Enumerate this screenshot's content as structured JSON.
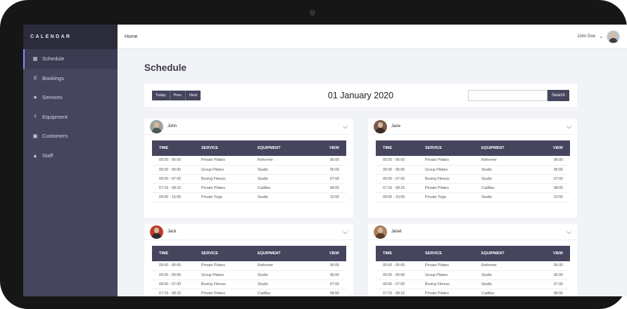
{
  "brand": "CALENDAR",
  "sidebar": {
    "items": [
      {
        "label": "Schedule",
        "icon": "calendar-icon"
      },
      {
        "label": "Bookings",
        "icon": "hourglass-icon"
      },
      {
        "label": "Services",
        "icon": "star-icon"
      },
      {
        "label": "Equipment",
        "icon": "dumbbell-icon"
      },
      {
        "label": "Customers",
        "icon": "id-card-icon"
      },
      {
        "label": "Staff",
        "icon": "user-icon"
      }
    ]
  },
  "topbar": {
    "breadcrumb": "Home",
    "user_name": "John Doe",
    "dropdown_icon": "chevron-down-icon"
  },
  "page": {
    "title": "Schedule"
  },
  "toolbar": {
    "today": "Today",
    "prev": "Prev",
    "next": "Next",
    "date": "01 January 2020",
    "search_placeholder": "",
    "search_button": "Search"
  },
  "columns": {
    "time": "TIME",
    "service": "SERVICE",
    "equipment": "EQUIPMENT",
    "view": "VIEW"
  },
  "colors": {
    "sidebar": "#45455e",
    "sidebar_dark": "#2b2b3b",
    "accent": "#8a8aff",
    "background": "#f2f3f7"
  },
  "cards": [
    {
      "name": "John",
      "rows": [
        [
          "05:00 - 06:00",
          "Private Pilates",
          "Reformer",
          "06:00"
        ],
        [
          "05:00 - 06:00",
          "Group Pilates",
          "Studio",
          "06:00"
        ],
        [
          "06:00 - 07:00",
          "Boxing Fitness",
          "Studio",
          "07:00"
        ],
        [
          "07:15 - 08:15",
          "Private Pilates",
          "Cadillac",
          "08:00"
        ],
        [
          "09:00 - 10:00",
          "Private Yoga",
          "Studio",
          "10:00"
        ]
      ]
    },
    {
      "name": "Jane",
      "rows": [
        [
          "05:00 - 06:00",
          "Private Pilates",
          "Reformer",
          "06:00"
        ],
        [
          "05:00 - 06:00",
          "Group Pilates",
          "Studio",
          "06:00"
        ],
        [
          "06:00 - 07:00",
          "Boxing Fitness",
          "Studio",
          "07:00"
        ],
        [
          "07:15 - 08:15",
          "Private Pilates",
          "Cadillac",
          "08:00"
        ],
        [
          "09:00 - 10:00",
          "Private Yoga",
          "Studio",
          "10:00"
        ]
      ]
    },
    {
      "name": "Jack",
      "rows": [
        [
          "05:00 - 06:00",
          "Private Pilates",
          "Reformer",
          "06:00"
        ],
        [
          "05:00 - 06:00",
          "Group Pilates",
          "Studio",
          "06:00"
        ],
        [
          "06:00 - 07:00",
          "Boxing Fitness",
          "Studio",
          "07:00"
        ],
        [
          "07:15 - 08:15",
          "Private Pilates",
          "Cadillac",
          "08:00"
        ]
      ]
    },
    {
      "name": "Janet",
      "rows": [
        [
          "05:00 - 06:00",
          "Private Pilates",
          "Reformer",
          "06:00"
        ],
        [
          "05:00 - 06:00",
          "Group Pilates",
          "Studio",
          "06:00"
        ],
        [
          "06:00 - 07:00",
          "Boxing Fitness",
          "Studio",
          "07:00"
        ],
        [
          "07:15 - 08:15",
          "Private Pilates",
          "Cadillac",
          "08:00"
        ]
      ]
    }
  ]
}
